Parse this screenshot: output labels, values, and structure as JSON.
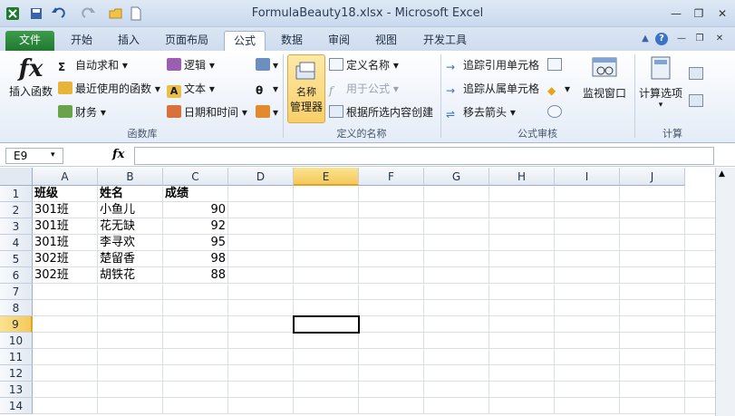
{
  "title": "FormulaBeauty18.xlsx - Microsoft Excel",
  "tabs": [
    "文件",
    "开始",
    "插入",
    "页面布局",
    "公式",
    "数据",
    "审阅",
    "视图",
    "开发工具"
  ],
  "active_tab": "公式",
  "ribbon": {
    "insert_function": "插入函数",
    "autosum": "自动求和",
    "recent": "最近使用的函数",
    "financial": "财务",
    "logical": "逻辑",
    "text": "文本",
    "datetime": "日期和时间",
    "group1": "函数库",
    "name_manager": "管理器",
    "name_manager_top": "名称",
    "define_name": "定义名称",
    "use_in_formula": "用于公式",
    "create_from_sel": "根据所选内容创建",
    "group2": "定义的名称",
    "trace_precedents": "追踪引用单元格",
    "trace_dependents": "追踪从属单元格",
    "remove_arrows": "移去箭头",
    "watch_window": "监视窗口",
    "group3": "公式审核",
    "calc_options": "计算选项",
    "group4": "计算"
  },
  "namebox": "E9",
  "fx": "fx",
  "columns": [
    "A",
    "B",
    "C",
    "D",
    "E",
    "F",
    "G",
    "H",
    "I",
    "J"
  ],
  "selected_column": "E",
  "selected_row": "9",
  "rows": [
    "1",
    "2",
    "3",
    "4",
    "5",
    "6",
    "7",
    "8",
    "9",
    "10",
    "11",
    "12",
    "13",
    "14"
  ],
  "table": [
    [
      "班级",
      "姓名",
      "成绩"
    ],
    [
      "301班",
      "小鱼儿",
      "90"
    ],
    [
      "301班",
      "花无缺",
      "92"
    ],
    [
      "301班",
      "李寻欢",
      "95"
    ],
    [
      "302班",
      "楚留香",
      "98"
    ],
    [
      "302班",
      "胡铁花",
      "88"
    ]
  ],
  "colors": {
    "file_tab": "#1f7a2f",
    "selection": "#f4c95b",
    "header": "#e3e9f2"
  }
}
